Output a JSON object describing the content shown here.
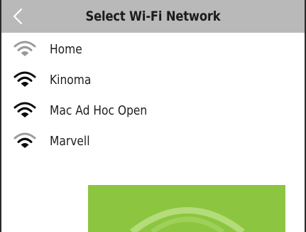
{
  "header": {
    "title": "Select Wi-Fi Network",
    "back_icon": "chevron-left-icon"
  },
  "networks": [
    {
      "name": "Home",
      "signal": "weak",
      "icon": "wifi-icon"
    },
    {
      "name": "Kinoma",
      "signal": "strong",
      "icon": "wifi-icon"
    },
    {
      "name": "Mac Ad Hoc Open",
      "signal": "strong",
      "icon": "wifi-icon"
    },
    {
      "name": "Marvell",
      "signal": "weak",
      "icon": "wifi-icon"
    }
  ],
  "colors": {
    "header_bg": "#b9b9b9",
    "wifi_strong": "#0b0b0b",
    "wifi_weak": "#9a9a9a",
    "accent_green": "#8cc640"
  }
}
